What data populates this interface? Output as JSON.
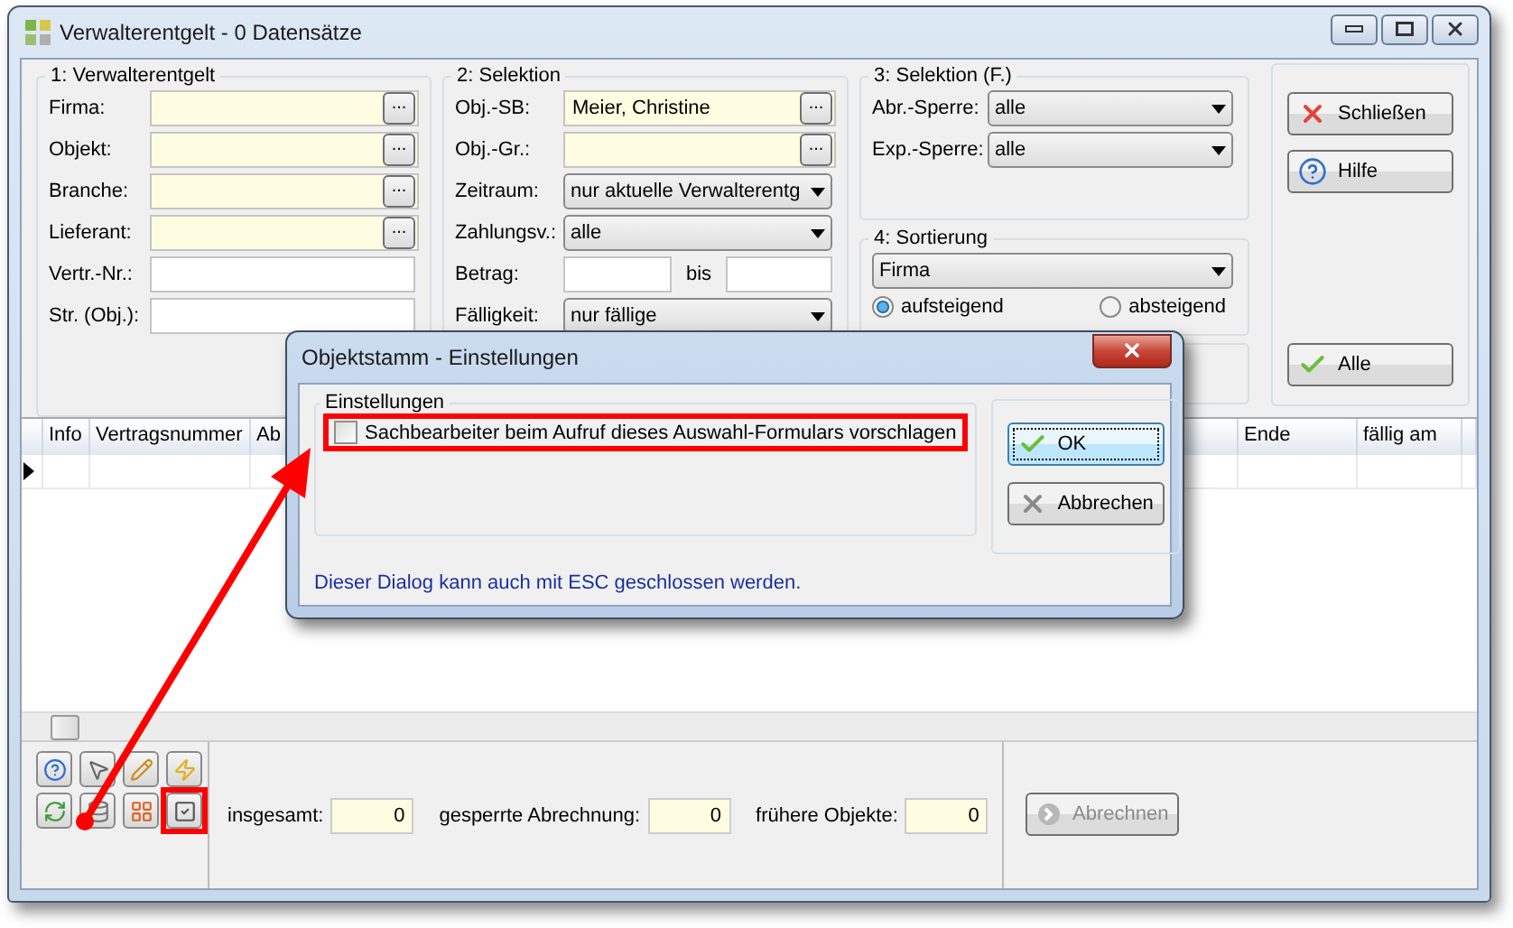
{
  "window": {
    "title": "Verwalterentgelt - 0 Datensätze"
  },
  "group1": {
    "title": "1: Verwalterentgelt",
    "fields": [
      {
        "label": "Firma:",
        "kind": "lookup",
        "button": "..."
      },
      {
        "label": "Objekt:",
        "kind": "lookup",
        "button": "..."
      },
      {
        "label": "Branche:",
        "kind": "lookup",
        "button": "..."
      },
      {
        "label": "Lieferant:",
        "kind": "lookup",
        "button": "..."
      },
      {
        "label": "Vertr.-Nr.:",
        "kind": "text"
      },
      {
        "label": "Str. (Obj.):",
        "kind": "text"
      }
    ]
  },
  "group2": {
    "title": "2: Selektion",
    "fields": [
      {
        "label": "Obj.-SB:",
        "kind": "lookup",
        "value": "Meier, Christine",
        "button": "..."
      },
      {
        "label": "Obj.-Gr.:",
        "kind": "lookup",
        "button": "..."
      },
      {
        "label": "Zeitraum:",
        "kind": "select",
        "value": "nur aktuelle Verwalterentg"
      },
      {
        "label": "Zahlungsv.:",
        "kind": "select",
        "value": "alle"
      },
      {
        "label": "Betrag:",
        "kind": "range",
        "between": "bis"
      },
      {
        "label": "Fälligkeit:",
        "kind": "select",
        "value": "nur fällige"
      }
    ]
  },
  "group3": {
    "title": "3: Selektion (F.)",
    "fields": [
      {
        "label": "Abr.-Sperre:",
        "kind": "select",
        "value": "alle"
      },
      {
        "label": "Exp.-Sperre:",
        "kind": "select",
        "value": "alle"
      }
    ]
  },
  "group4": {
    "title": "4: Sortierung",
    "sort": "Firma",
    "options": [
      {
        "label": "aufsteigend",
        "selected": true
      },
      {
        "label": "absteigend",
        "selected": false
      }
    ]
  },
  "buttons": [
    {
      "label": "Schließen",
      "kind": "close"
    },
    {
      "label": "Hilfe",
      "kind": "help"
    },
    {
      "label": "Alle",
      "kind": "all"
    }
  ],
  "table": {
    "columns": [
      "Info",
      "Vertragsnummer",
      "Ab",
      "Ende",
      "fällig am"
    ]
  },
  "stats": [
    {
      "label": "insgesamt:",
      "value": "0"
    },
    {
      "label": "gesperrte Abrechnung:",
      "value": "0"
    },
    {
      "label": "frühere Objekte:",
      "value": "0"
    }
  ],
  "action": {
    "label": "Abrechnen",
    "disabled": true
  },
  "dialog": {
    "title": "Objektstamm - Einstellungen",
    "group": "Einstellungen",
    "option": {
      "label": "Sachbearbeiter beim Aufruf dieses Auswahl-Formulars vorschlagen",
      "checked": false
    },
    "buttons": [
      {
        "label": "OK",
        "kind": "ok",
        "default": true
      },
      {
        "label": "Abbrechen",
        "kind": "cancel",
        "default": false
      }
    ],
    "hint": "Dieser Dialog kann auch mit ESC geschlossen werden."
  }
}
